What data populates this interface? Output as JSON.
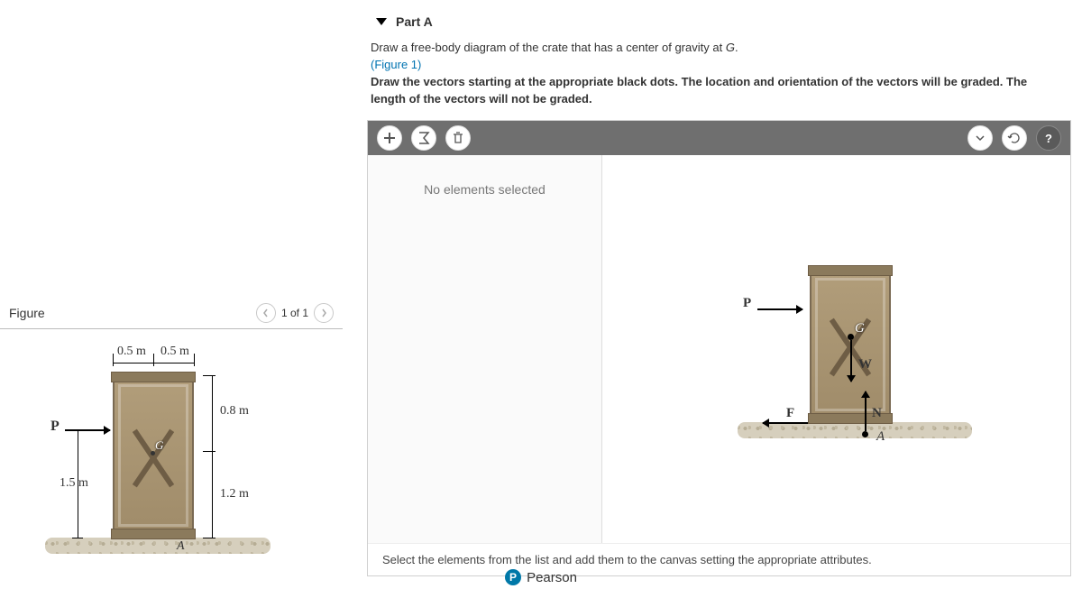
{
  "figure_panel": {
    "title": "Figure",
    "pager": {
      "text": "1 of 1"
    },
    "dims": {
      "half_width_left": "0.5 m",
      "half_width_right": "0.5 m",
      "top_offset": "0.8 m",
      "bottom_offset": "1.2 m",
      "force_height": "1.5 m"
    },
    "force_label": "P",
    "g_label": "G",
    "point_A": "A"
  },
  "part": {
    "title": "Part A",
    "instruction_main": "Draw a free-body diagram of the crate that has a center of gravity at ",
    "instruction_var": "G",
    "instruction_end": ".",
    "figure_ref": "(Figure 1)",
    "instruction_bold": "Draw the vectors starting at the appropriate black dots. The location and orientation of the vectors will be graded. The length of the vectors will not be graded."
  },
  "canvas": {
    "props_placeholder": "No elements selected",
    "labels": {
      "P": "P",
      "F": "F",
      "W": "W",
      "N": "N",
      "G": "G",
      "A": "A"
    },
    "hint": "Select the elements from the list and add them to the canvas setting the appropriate attributes."
  },
  "footer": {
    "brand": "Pearson",
    "logo_letter": "P"
  },
  "icons": {
    "add": "add-icon",
    "sigma": "sigma-icon",
    "trash": "trash-icon",
    "caret": "caret-down-icon",
    "reset": "reset-icon",
    "help": "help-icon"
  }
}
